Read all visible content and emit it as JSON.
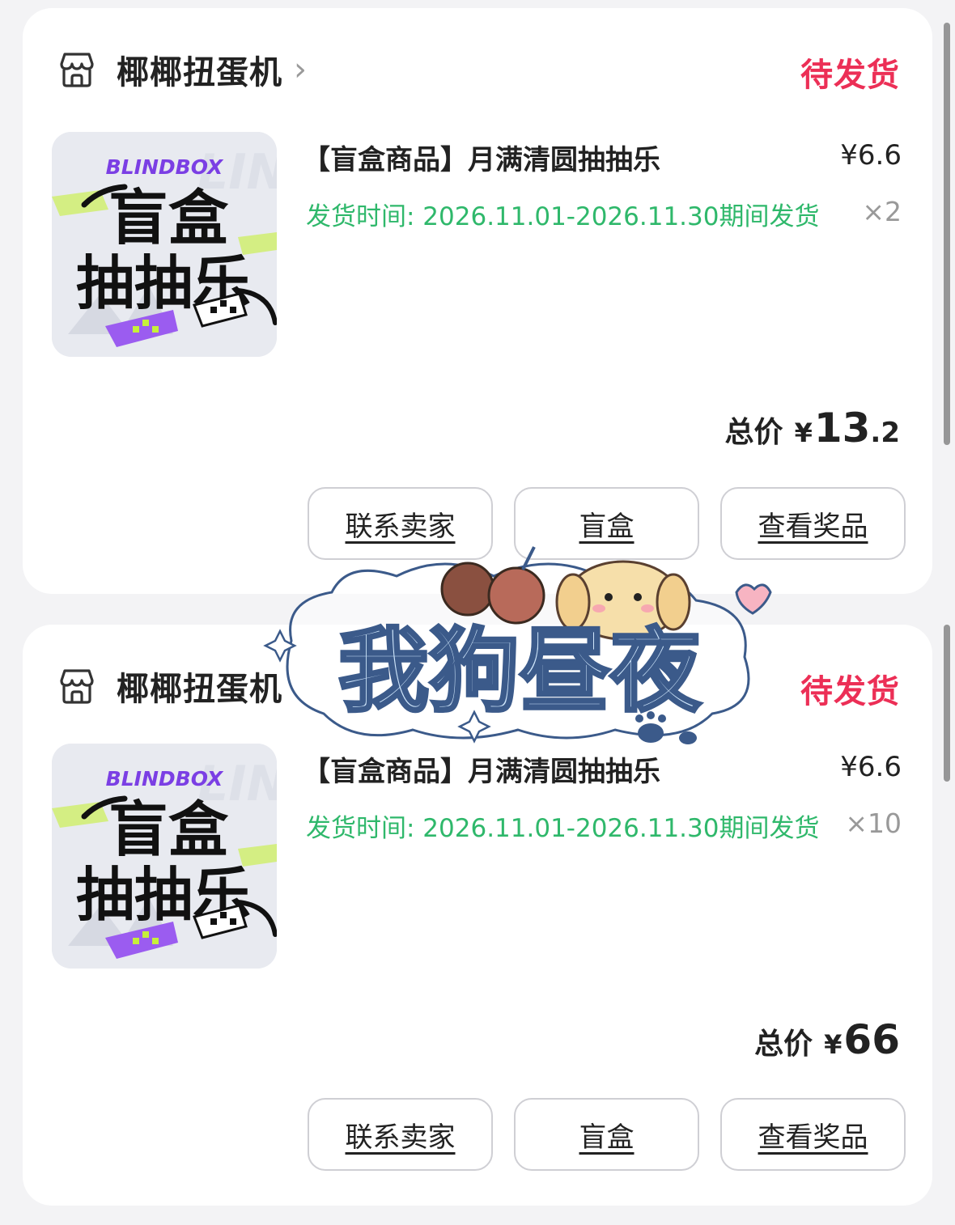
{
  "orders": [
    {
      "shop_name": "椰椰扭蛋机",
      "status": "待发货",
      "product_title": "【盲盒商品】月满清圆抽抽乐",
      "price": "¥6.6",
      "ship_time": "发货时间: 2026.11.01-2026.11.30期间发货",
      "quantity": "×2",
      "total_label": "总价",
      "total_currency": "¥",
      "total_int": "13",
      "total_dec": ".2",
      "buttons": [
        "联系卖家",
        "盲盒",
        "查看奖品"
      ],
      "thumb": {
        "brand": "BLINDBOX",
        "line1": "盲盒",
        "line2": "抽抽乐"
      }
    },
    {
      "shop_name": "椰椰扭蛋机",
      "status": "待发货",
      "product_title": "【盲盒商品】月满清圆抽抽乐",
      "price": "¥6.6",
      "ship_time": "发货时间: 2026.11.01-2026.11.30期间发货",
      "quantity": "×10",
      "total_label": "总价",
      "total_currency": "¥",
      "total_int": "66",
      "total_dec": "",
      "buttons": [
        "联系卖家",
        "盲盒",
        "查看奖品"
      ],
      "thumb": {
        "brand": "BLINDBOX",
        "line1": "盲盒",
        "line2": "抽抽乐"
      }
    }
  ],
  "watermark_text": "我狗昼夜",
  "colors": {
    "status": "#ec2f56",
    "ship": "#2fb86b",
    "qty": "#999999",
    "brand": "#7b3fe4",
    "accent_green": "#c6f03a"
  },
  "icons": [
    "shop-icon",
    "chevron-right-icon"
  ]
}
